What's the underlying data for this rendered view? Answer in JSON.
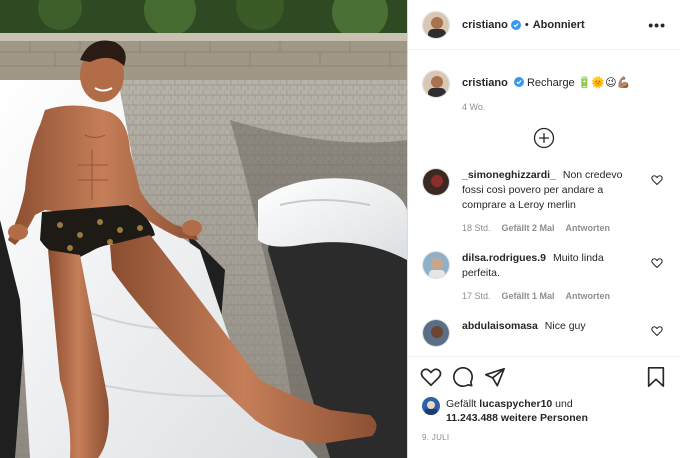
{
  "post": {
    "username": "cristiano",
    "follow_separator": "•",
    "follow_status": "Abonniert",
    "more_label": "•••"
  },
  "caption": {
    "username": "cristiano",
    "text": "Recharge 🔋🌞😉💪🏽",
    "time": "4 Wo."
  },
  "comments": [
    {
      "author": "_simoneghizzardi_",
      "text": "Non credevo fossi così povero per andare a comprare a Leroy merlin",
      "time": "18 Std.",
      "likes": "Gefällt 2 Mal",
      "reply": "Antworten"
    },
    {
      "author": "dilsa.rodrigues.9",
      "text": "Muito linda perfeita.",
      "time": "17 Std.",
      "likes": "Gefällt 1 Mal",
      "reply": "Antworten"
    },
    {
      "author": "abdulaisomasa",
      "text": "Nice guy"
    }
  ],
  "likes_line": {
    "prefix": "Gefällt",
    "user": "lucaspycher10",
    "conj": "und",
    "count": "11.243.488",
    "suffix": "weitere Personen"
  },
  "date": "9. JULI",
  "icons": {
    "like": "heart-icon",
    "comment": "comment-icon",
    "share": "share-icon",
    "save": "bookmark-icon",
    "load_more": "plus-circle-icon",
    "verified": "verified-badge-icon"
  },
  "colors": {
    "verified": "#3897f0",
    "text": "#262626",
    "muted": "#8e8e8e",
    "border": "#dbdbdb"
  }
}
